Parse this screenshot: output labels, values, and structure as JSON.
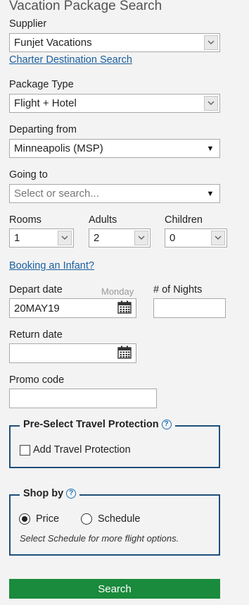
{
  "page_title": "Vacation Package Search",
  "supplier": {
    "label": "Supplier",
    "value": "Funjet Vacations"
  },
  "charter_link": "Charter Destination Search",
  "package_type": {
    "label": "Package Type",
    "value": "Flight + Hotel"
  },
  "departing_from": {
    "label": "Departing from",
    "value": "Minneapolis (MSP)"
  },
  "going_to": {
    "label": "Going to",
    "placeholder": "Select or search..."
  },
  "rooms": {
    "label": "Rooms",
    "value": "1"
  },
  "adults": {
    "label": "Adults",
    "value": "2"
  },
  "children": {
    "label": "Children",
    "value": "0"
  },
  "infant_link": "Booking an Infant?",
  "depart_date": {
    "label": "Depart date",
    "day_hint": "Monday",
    "value": "20MAY19"
  },
  "nights": {
    "label": "# of Nights",
    "value": ""
  },
  "return_date": {
    "label": "Return date",
    "value": ""
  },
  "promo_code": {
    "label": "Promo code",
    "value": ""
  },
  "travel_protection": {
    "legend": "Pre-Select Travel Protection",
    "help_glyph": "?",
    "checkbox_label": "Add Travel Protection",
    "checked": false
  },
  "shop_by": {
    "legend": "Shop by",
    "help_glyph": "?",
    "options": [
      {
        "label": "Price",
        "selected": true
      },
      {
        "label": "Schedule",
        "selected": false
      }
    ],
    "note": "Select Schedule for more flight options."
  },
  "search_button": "Search",
  "colors": {
    "link": "#1a5f9e",
    "fieldset_border": "#1f4f7a",
    "search_button_bg": "#1a8a3c",
    "help_icon": "#1f6fb5"
  }
}
